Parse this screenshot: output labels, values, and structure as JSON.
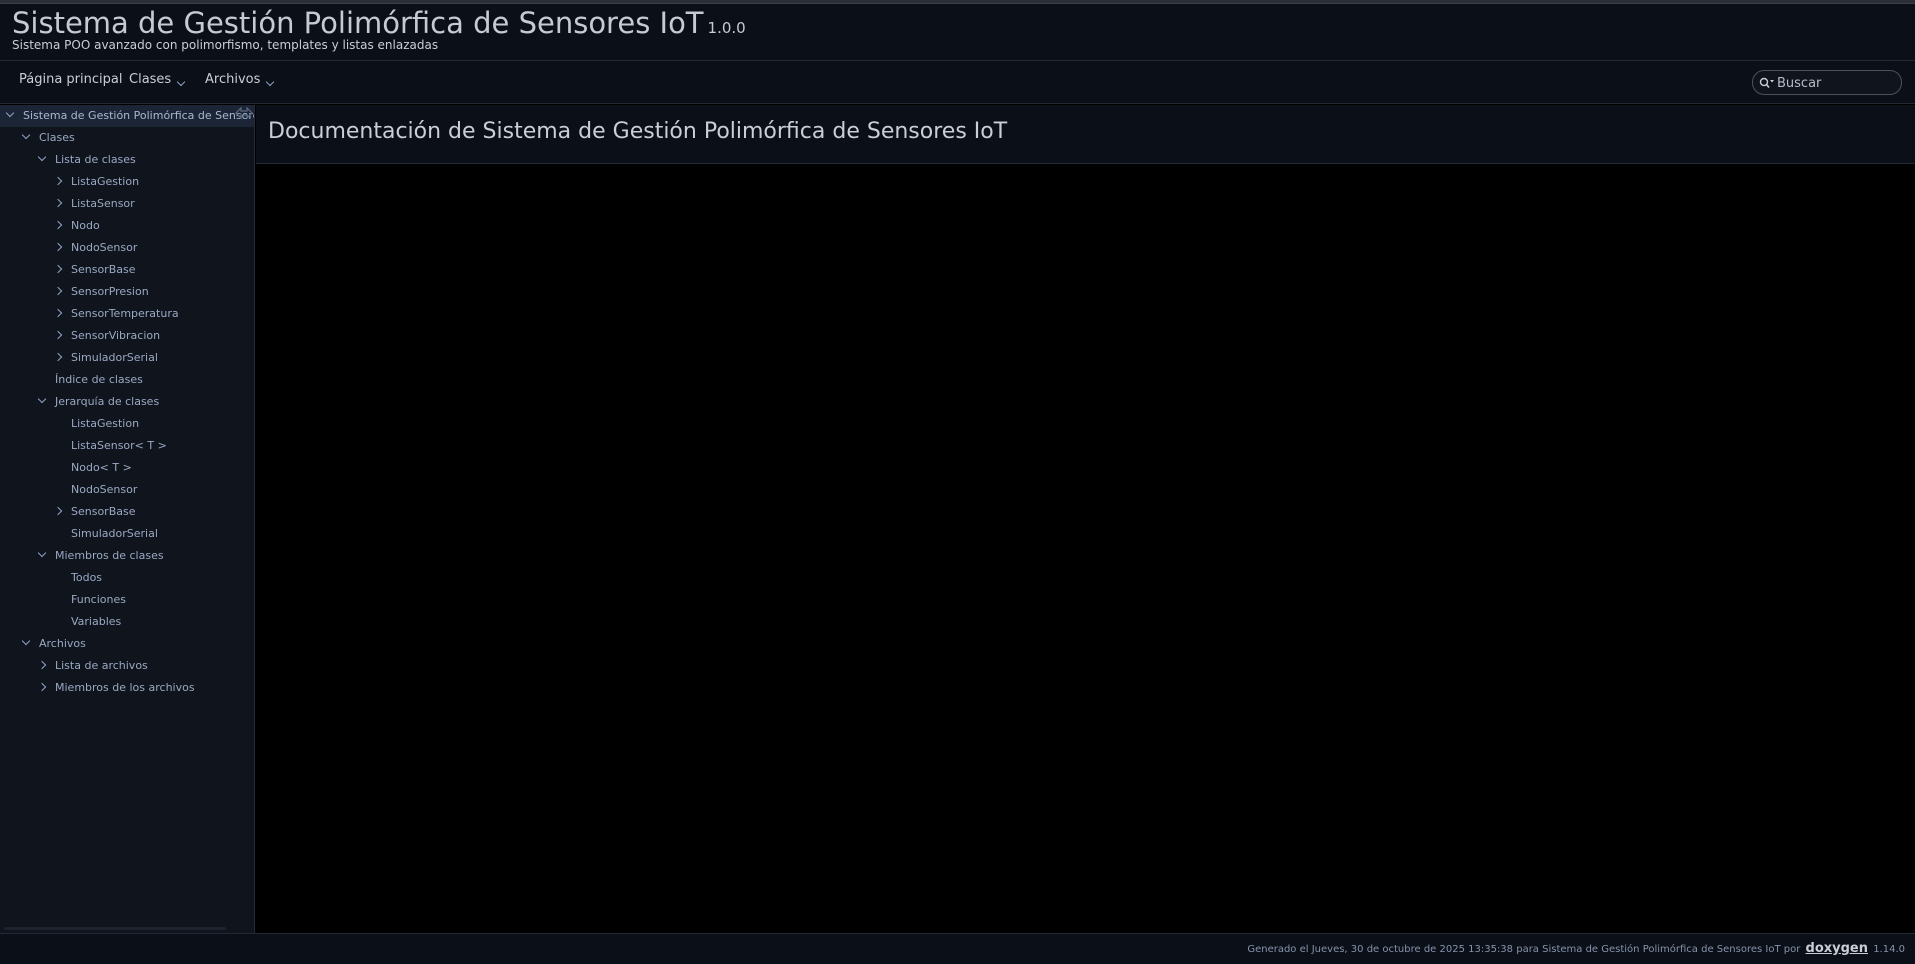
{
  "header": {
    "project_name": "Sistema de Gestión Polimórfica de Sensores IoT",
    "project_number": "1.0.0",
    "project_brief": "Sistema POO avanzado con polimorfismo, templates y listas enlazadas"
  },
  "navbar": {
    "items": [
      {
        "label": "Página principal"
      },
      {
        "label": "Clases"
      },
      {
        "label": "Archivos"
      }
    ],
    "search_placeholder": "Buscar"
  },
  "sidebar": {
    "tree": [
      {
        "label": "Sistema de Gestión Polimórfica de Sensores IoT",
        "arrow": "down",
        "selected": true
      },
      {
        "label": "Clases",
        "arrow": "down"
      },
      {
        "label": "Lista de clases",
        "arrow": "down"
      },
      {
        "label": "ListaGestion",
        "arrow": "right"
      },
      {
        "label": "ListaSensor",
        "arrow": "right"
      },
      {
        "label": "Nodo",
        "arrow": "right"
      },
      {
        "label": "NodoSensor",
        "arrow": "right"
      },
      {
        "label": "SensorBase",
        "arrow": "right"
      },
      {
        "label": "SensorPresion",
        "arrow": "right"
      },
      {
        "label": "SensorTemperatura",
        "arrow": "right"
      },
      {
        "label": "SensorVibracion",
        "arrow": "right"
      },
      {
        "label": "SimuladorSerial",
        "arrow": "right"
      },
      {
        "label": "Índice de clases",
        "arrow": "none"
      },
      {
        "label": "Jerarquía de clases",
        "arrow": "down"
      },
      {
        "label": "ListaGestion",
        "arrow": "none"
      },
      {
        "label": "ListaSensor< T >",
        "arrow": "none"
      },
      {
        "label": "Nodo< T >",
        "arrow": "none"
      },
      {
        "label": "NodoSensor",
        "arrow": "none"
      },
      {
        "label": "SensorBase",
        "arrow": "right"
      },
      {
        "label": "SimuladorSerial",
        "arrow": "none"
      },
      {
        "label": "Miembros de clases",
        "arrow": "down"
      },
      {
        "label": "Todos",
        "arrow": "none"
      },
      {
        "label": "Funciones",
        "arrow": "none"
      },
      {
        "label": "Variables",
        "arrow": "none"
      },
      {
        "label": "Archivos",
        "arrow": "down"
      },
      {
        "label": "Lista de archivos",
        "arrow": "right"
      },
      {
        "label": "Miembros de los archivos",
        "arrow": "right"
      }
    ]
  },
  "main": {
    "title": "Documentación de Sistema de Gestión Polimórfica de Sensores IoT"
  },
  "footer": {
    "generated_text": "Generado el Jueves, 30 de octubre de 2025 13:35:38 para Sistema de Gestión Polimórfica de Sensores IoT por",
    "generator_name": "doxygen",
    "generator_version": "1.14.0"
  },
  "icons": {
    "search": "search-icon",
    "sync": "sync-icon",
    "expand": "chevron-down-icon",
    "collapse": "chevron-right-icon"
  },
  "colors": {
    "background": "#000000",
    "header_bg": "#0b0f17",
    "sidebar_bg": "#0f141d",
    "text": "#c9ced7",
    "tree_text": "#9aa9c2",
    "accent": "#8fa4c6"
  }
}
